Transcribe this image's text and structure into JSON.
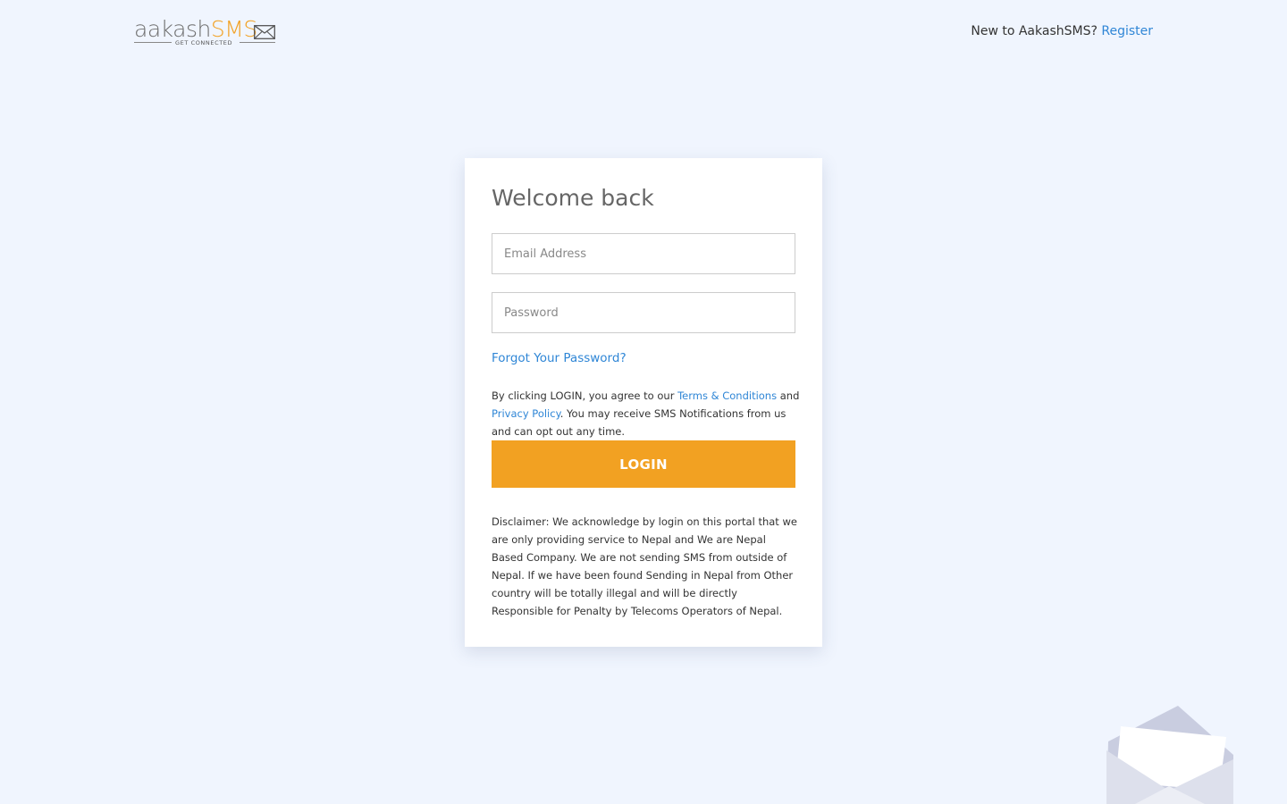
{
  "header": {
    "logo": {
      "brand_part1": "aakash",
      "brand_part2": "SMS",
      "tagline": "GET CONNECTED"
    },
    "prompt_text": "New to AakashSMS?",
    "register_link": "Register"
  },
  "login_card": {
    "title": "Welcome back",
    "email_placeholder": "Email Address",
    "email_value": "",
    "password_placeholder": "Password",
    "password_value": "",
    "forgot_link": "Forgot Your Password?",
    "terms": {
      "prefix": "By clicking LOGIN, you agree to our ",
      "terms_link": "Terms & Conditions",
      "middle": " and ",
      "privacy_link": "Privacy Policy",
      "suffix": ". You may receive SMS Notifications from us and can opt out any time."
    },
    "login_button": "LOGIN",
    "disclaimer": "Disclaimer: We acknowledge by login on this portal that we are only providing service to Nepal and We are Nepal Based Company. We are not sending SMS from outside of Nepal. If we have been found Sending in Nepal from Other country will be totally illegal and will be directly Responsible for Penalty by Telecoms Operators of Nepal."
  },
  "colors": {
    "background": "#f0f5fe",
    "accent": "#f2a122",
    "link": "#2f86d6",
    "card": "#ffffff"
  },
  "icons": {
    "logo_envelope": "envelope-icon",
    "decorative_art": "open-envelope-illustration"
  }
}
